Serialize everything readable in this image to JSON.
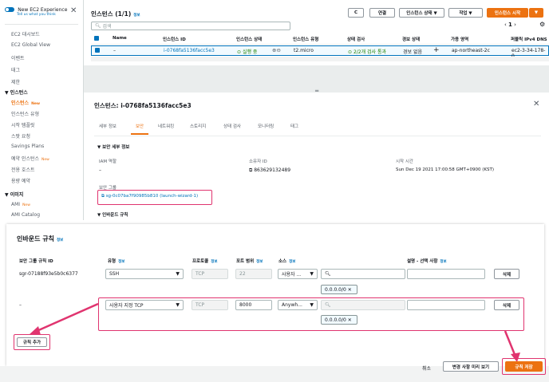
{
  "sidebar": {
    "title": "New EC2 Experience",
    "subtitle": "Tell us what you think",
    "links_top": [
      "EC2 대시보드",
      "EC2 Global View",
      "이벤트",
      "태그",
      "제한"
    ],
    "section1": "인스턴스",
    "section1_items": [
      {
        "label": "인스턴스",
        "badge": "New"
      },
      {
        "label": "인스턴스 유형",
        "badge": ""
      },
      {
        "label": "시작 템플릿",
        "badge": ""
      },
      {
        "label": "스팟 요청",
        "badge": ""
      },
      {
        "label": "Savings Plans",
        "badge": ""
      },
      {
        "label": "예약 인스턴스",
        "badge": "New"
      },
      {
        "label": "전용 호스트",
        "badge": ""
      },
      {
        "label": "용량 예약",
        "badge": ""
      }
    ],
    "section2": "이미지",
    "section2_items": [
      {
        "label": "AMI",
        "badge": "New"
      },
      {
        "label": "AMI Catalog",
        "badge": ""
      }
    ]
  },
  "instances": {
    "title": "인스턴스 (1/1)",
    "info": "정보",
    "search_placeholder": "검색",
    "buttons": {
      "connect": "연결",
      "state": "인스턴스 상태 ▼",
      "actions": "작업 ▼",
      "launch": "인스턴스 시작",
      "launch_caret": "▼"
    },
    "page": "1",
    "columns": [
      "Name",
      "인스턴스 ID",
      "인스턴스 상태",
      "인스턴스 유형",
      "상태 검사",
      "경보 상태",
      "가용 영역",
      "퍼블릭 IPv4 DNS"
    ],
    "row": {
      "name": "–",
      "id": "i-0768fa5136facc5e3",
      "state": "실행 중",
      "type": "t2.micro",
      "check": "2/2개 검사 통과",
      "alarm": "경보 없음",
      "az": "ap-northeast-2c",
      "dns": "ec2-3-34-178-0"
    }
  },
  "detail": {
    "title": "인스턴스: i-0768fa5136facc5e3",
    "tabs": [
      "세부 정보",
      "보안",
      "네트워킹",
      "스토리지",
      "상태 검사",
      "모니터링",
      "태그"
    ],
    "security_heading": "보안 세부 정보",
    "iam_label": "IAM 역할",
    "iam_value": "–",
    "owner_label": "소유자 ID",
    "owner_value": "863629132489",
    "launch_label": "시작 시간",
    "launch_value": "Sun Dec 19 2021 17:00:58 GMT+0900 (KST)",
    "sg_label": "보안 그룹",
    "sg_value": "sg-0c07ba7f90985b810 (launch-wizard-1)",
    "inbound_heading": "인바운드 규칙"
  },
  "rules": {
    "title": "인바운드 규칙",
    "info": "정보",
    "headers": {
      "id": "보안 그룹 규칙 ID",
      "type": "유형",
      "protocol": "프로토콜",
      "port": "포트 범위",
      "source": "소스",
      "desc": "설명 - 선택 사항"
    },
    "rows": [
      {
        "id": "sgr-07188f93e5b0c6377",
        "type": "SSH",
        "protocol": "TCP",
        "port": "22",
        "source": "사용자 ...",
        "cidr": "0.0.0.0/0",
        "delete": "삭제"
      },
      {
        "id": "–",
        "type": "사용자 지정 TCP",
        "protocol": "TCP",
        "port": "8000",
        "source": "Anywh...",
        "cidr": "0.0.0.0/0",
        "delete": "삭제"
      }
    ],
    "add_rule": "규칙 추가",
    "cancel": "취소",
    "preview": "변경 사항 미리 보기",
    "save": "규칙 저장"
  },
  "colors": {
    "accent": "#ec7211",
    "link": "#0073bb",
    "highlight": "#e0346f",
    "ok": "#1d8102"
  }
}
